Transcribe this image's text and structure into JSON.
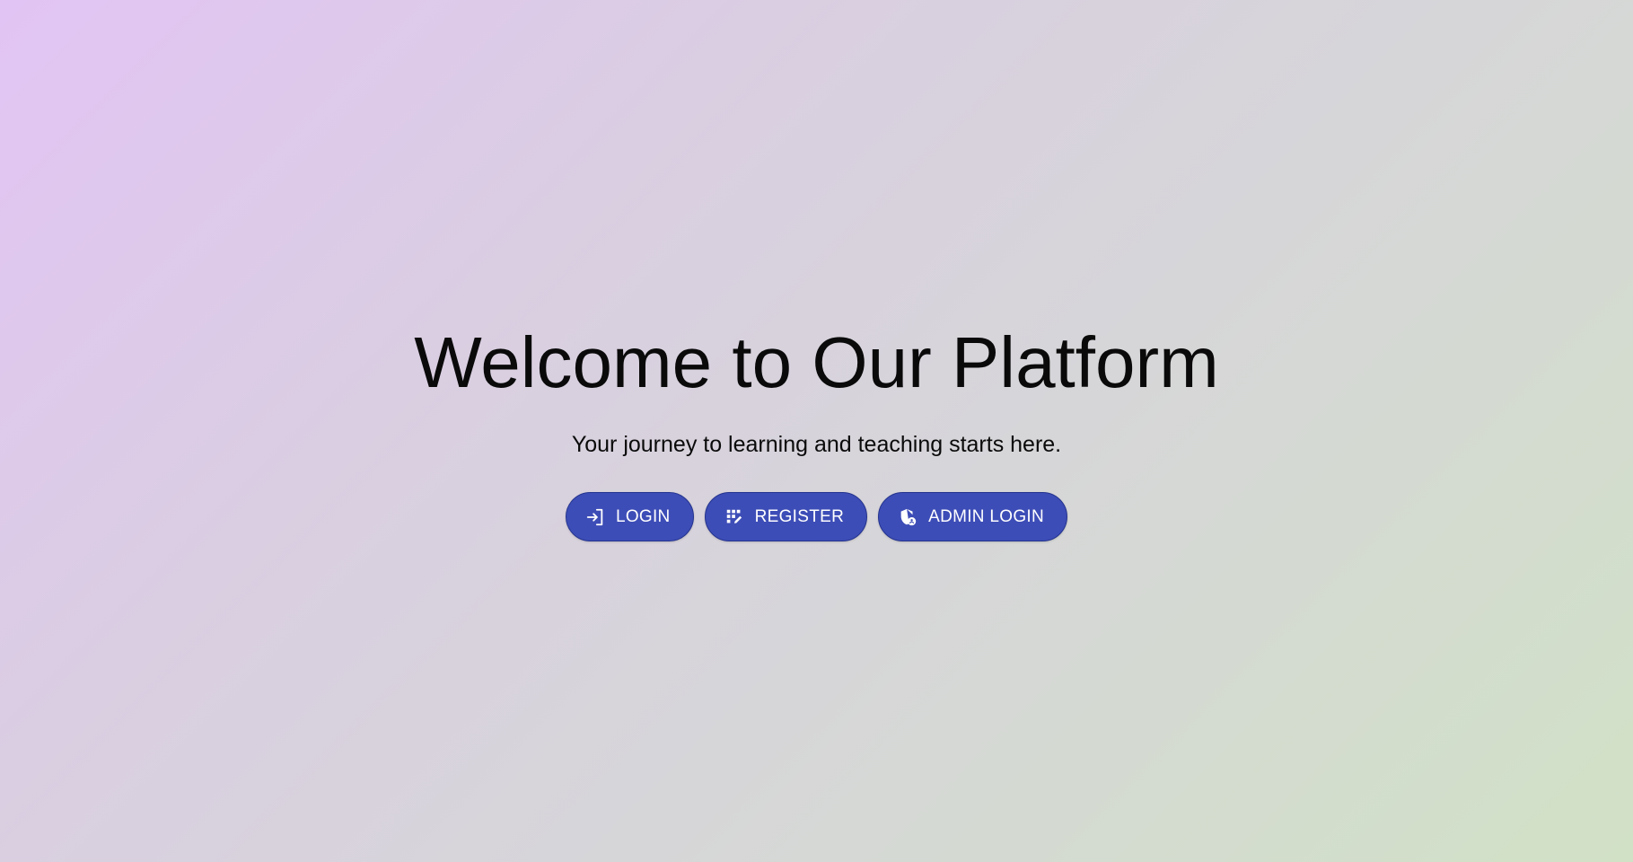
{
  "hero": {
    "title": "Welcome to Our Platform",
    "subtitle": "Your journey to learning and teaching starts here."
  },
  "actions": {
    "login": {
      "label": "LOGIN",
      "icon": "login-icon"
    },
    "register": {
      "label": "REGISTER",
      "icon": "app-registration-icon"
    },
    "admin_login": {
      "label": "ADMIN LOGIN",
      "icon": "admin-shield-icon"
    }
  },
  "colors": {
    "button_bg": "#3d4db7",
    "button_text": "#ffffff",
    "text": "#0a0a0a",
    "gradient_start": "#e2c4f4",
    "gradient_end": "#d1e1c6"
  }
}
